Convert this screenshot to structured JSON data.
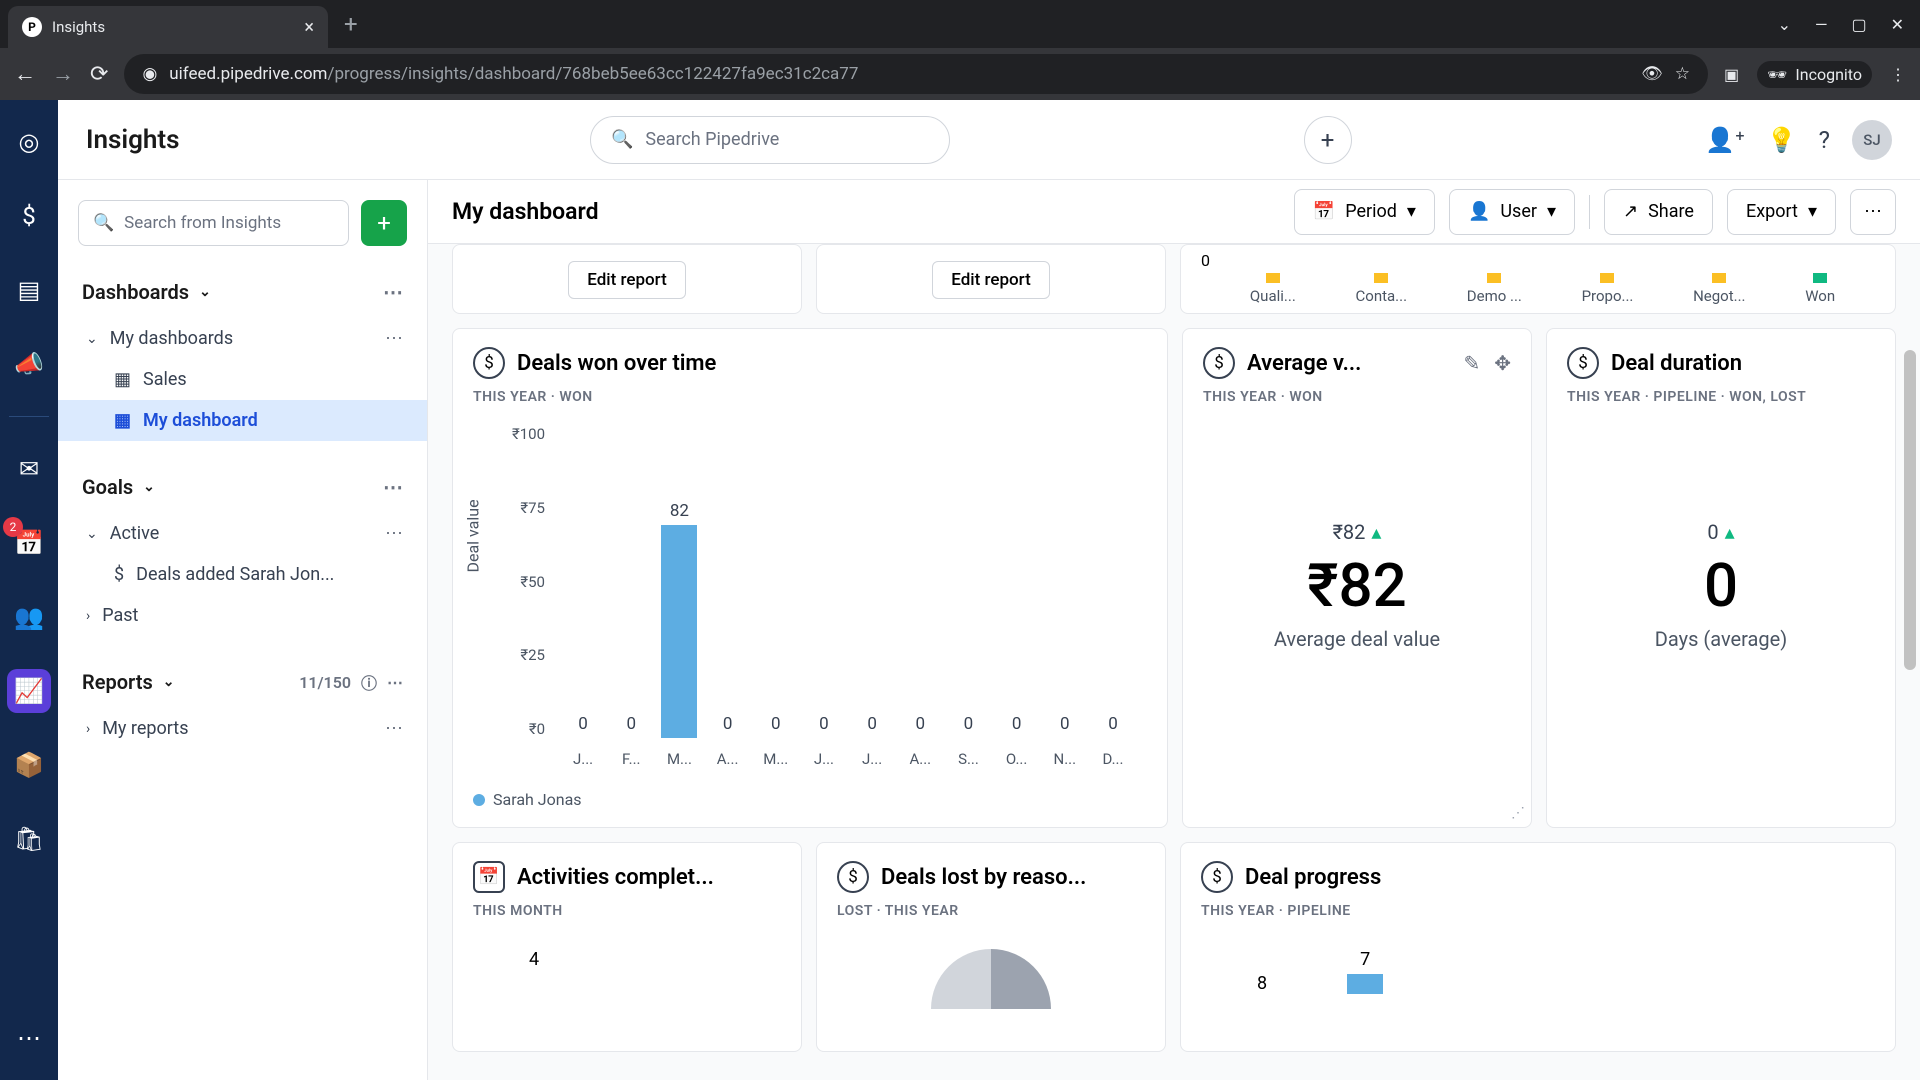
{
  "browser": {
    "tab_title": "Insights",
    "url_domain": "uifeed.pipedrive.com",
    "url_path": "/progress/insights/dashboard/768beb5ee63cc122427fa9ec31c2ca77",
    "incognito": "Incognito"
  },
  "header": {
    "title": "Insights",
    "search_placeholder": "Search Pipedrive",
    "avatar_initials": "SJ"
  },
  "rail": {
    "badge_count": "2"
  },
  "sidebar": {
    "search_placeholder": "Search from Insights",
    "sections": {
      "dashboards": "Dashboards",
      "my_dashboards": "My dashboards",
      "items": [
        "Sales",
        "My dashboard"
      ],
      "goals": "Goals",
      "active": "Active",
      "goal_item": "Deals added Sarah Jon...",
      "past": "Past",
      "reports": "Reports",
      "reports_count": "11/150",
      "my_reports": "My reports"
    }
  },
  "toolbar": {
    "dashboard_title": "My dashboard",
    "period": "Period",
    "user": "User",
    "share": "Share",
    "export": "Export"
  },
  "partial": {
    "edit_report": "Edit report",
    "stage_zero": "0",
    "stages": [
      "Quali...",
      "Conta...",
      "Demo ...",
      "Propo...",
      "Negot...",
      "Won"
    ]
  },
  "cards": {
    "deals_won": {
      "title": "Deals won over time",
      "sub": "THIS YEAR  ·  WON",
      "y_label": "Deal value",
      "legend": "Sarah Jonas"
    },
    "avg_value": {
      "title": "Average v...",
      "sub": "THIS YEAR  ·  WON",
      "delta": "₹82",
      "value": "₹82",
      "label": "Average deal value"
    },
    "duration": {
      "title": "Deal duration",
      "sub": "THIS YEAR  ·  PIPELINE  ·  WON, LOST",
      "delta": "0",
      "value": "0",
      "label": "Days (average)"
    },
    "activities": {
      "title": "Activities complet...",
      "sub": "THIS MONTH",
      "val": "4"
    },
    "lost": {
      "title": "Deals lost by reaso...",
      "sub": "LOST  ·  THIS YEAR"
    },
    "progress": {
      "title": "Deal progress",
      "sub": "THIS YEAR  ·  PIPELINE",
      "v1": "8",
      "v2": "7"
    }
  },
  "chart_data": {
    "type": "bar",
    "title": "Deals won over time",
    "ylabel": "Deal value",
    "categories": [
      "J...",
      "F...",
      "M...",
      "A...",
      "M...",
      "J...",
      "J...",
      "A...",
      "S...",
      "O...",
      "N...",
      "D..."
    ],
    "y_ticks": [
      "₹100",
      "₹75",
      "₹50",
      "₹25",
      "₹0"
    ],
    "series": [
      {
        "name": "Sarah Jonas",
        "values": [
          0,
          0,
          82,
          0,
          0,
          0,
          0,
          0,
          0,
          0,
          0,
          0
        ]
      }
    ],
    "ylim": [
      0,
      100
    ]
  }
}
